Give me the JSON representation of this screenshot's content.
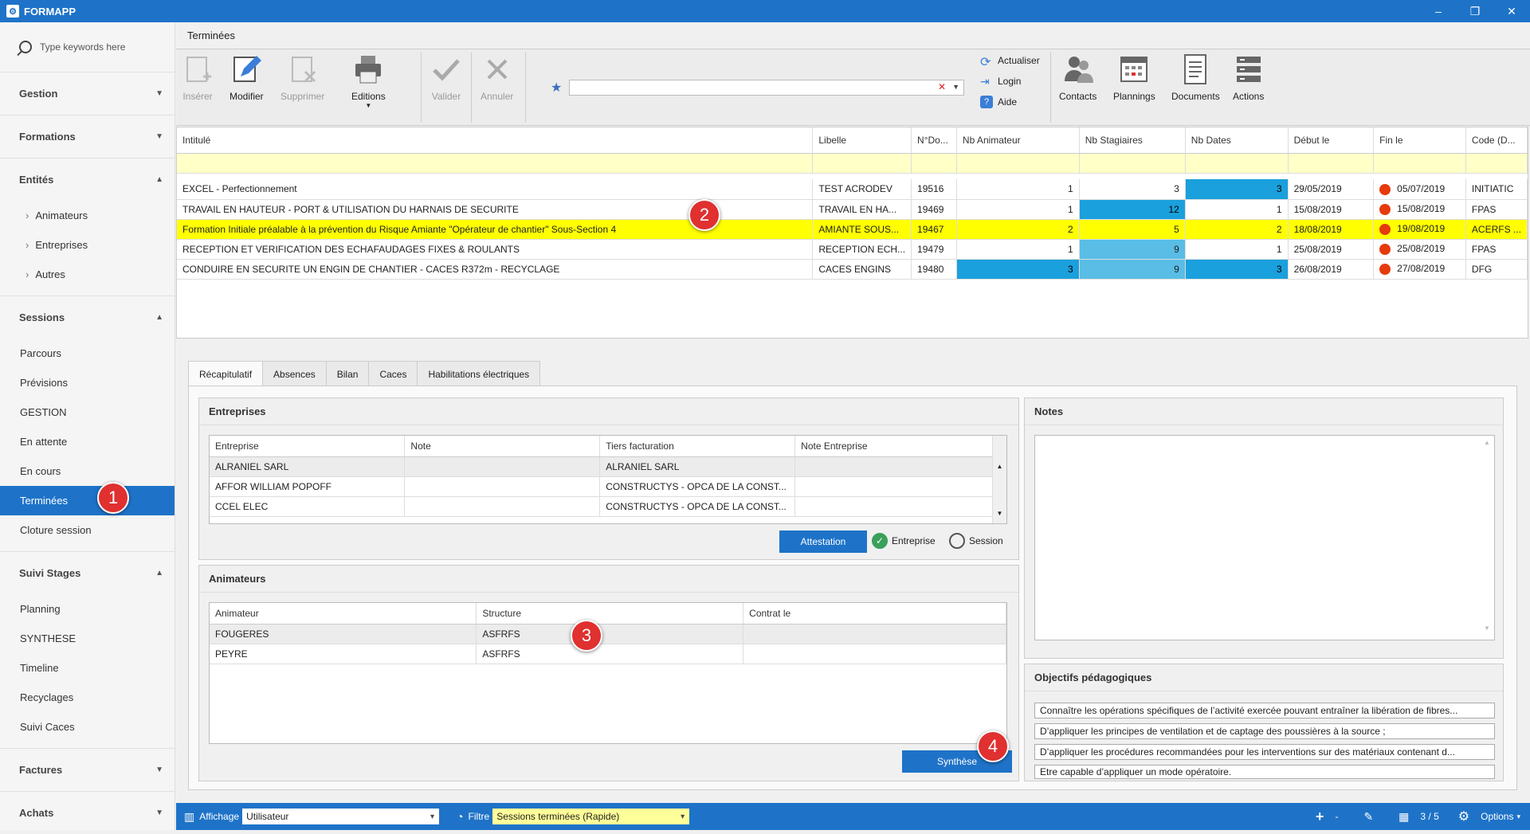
{
  "app": {
    "title": "FORMAPP"
  },
  "sidebar": {
    "search_placeholder": "Type keywords here",
    "groups": [
      {
        "label": "Gestion"
      },
      {
        "label": "Formations"
      },
      {
        "label": "Entités",
        "items": [
          "Animateurs",
          "Entreprises",
          "Autres"
        ]
      },
      {
        "label": "Sessions",
        "items": [
          "Parcours",
          "Prévisions",
          "GESTION",
          "En attente",
          "En cours",
          "Terminées",
          "Cloture session"
        ]
      },
      {
        "label": "Suivi Stages",
        "items": [
          "Planning",
          "SYNTHESE",
          "Timeline",
          "Recyclages",
          "Suivi Caces"
        ]
      },
      {
        "label": "Factures"
      },
      {
        "label": "Achats"
      }
    ]
  },
  "main": {
    "tab_title": "Terminées"
  },
  "ribbon": {
    "insert": "Insérer",
    "edit": "Modifier",
    "delete": "Supprimer",
    "editions": "Editions",
    "validate": "Valider",
    "cancel": "Annuler",
    "refresh": "Actualiser",
    "login": "Login",
    "help": "Aide",
    "contacts": "Contacts",
    "plannings": "Plannings",
    "documents": "Documents",
    "actions": "Actions"
  },
  "grid": {
    "columns": [
      "Intitulé",
      "Libelle",
      "N°Do...",
      "Nb Animateur",
      "Nb Stagiaires",
      "Nb Dates",
      "Début le",
      "Fin le",
      "Code (D..."
    ],
    "rows": [
      {
        "intitule": "EXCEL - Perfectionnement",
        "libelle": "TEST ACRODEV",
        "num": "19516",
        "anim": "1",
        "stag": "3",
        "dates": "3",
        "debut": "29/05/2019",
        "fin": "05/07/2019",
        "code": "INITIATIC"
      },
      {
        "intitule": "TRAVAIL EN HAUTEUR - PORT & UTILISATION DU HARNAIS DE SECURITE",
        "libelle": "TRAVAIL EN HA...",
        "num": "19469",
        "anim": "1",
        "stag": "12",
        "dates": "1",
        "debut": "15/08/2019",
        "fin": "15/08/2019",
        "code": "FPAS"
      },
      {
        "intitule": "Formation Initiale préalable à la prévention du Risque Amiante \"Opérateur de chantier\" Sous-Section 4",
        "libelle": "AMIANTE SOUS...",
        "num": "19467",
        "anim": "2",
        "stag": "5",
        "dates": "2",
        "debut": "18/08/2019",
        "fin": "19/08/2019",
        "code": "ACERFS ..."
      },
      {
        "intitule": "RECEPTION ET VERIFICATION DES ECHAFAUDAGES FIXES & ROULANTS",
        "libelle": "RECEPTION ECH...",
        "num": "19479",
        "anim": "1",
        "stag": "9",
        "dates": "1",
        "debut": "25/08/2019",
        "fin": "25/08/2019",
        "code": "FPAS"
      },
      {
        "intitule": "CONDUIRE EN SECURITE UN ENGIN DE CHANTIER - CACES R372m - RECYCLAGE",
        "libelle": "CACES ENGINS",
        "num": "19480",
        "anim": "3",
        "stag": "9",
        "dates": "3",
        "debut": "26/08/2019",
        "fin": "27/08/2019",
        "code": "DFG"
      }
    ]
  },
  "detail": {
    "tabs": [
      "Récapitulatif",
      "Absences",
      "Bilan",
      "Caces",
      "Habilitations électriques"
    ],
    "entreprises": {
      "title": "Entreprises",
      "columns": [
        "Entreprise",
        "Note",
        "Tiers facturation",
        "Note Entreprise"
      ],
      "rows": [
        [
          "ALRANIEL SARL",
          "",
          "ALRANIEL SARL",
          ""
        ],
        [
          "AFFOR WILLIAM POPOFF",
          "",
          "CONSTRUCTYS - OPCA DE LA CONST...",
          ""
        ],
        [
          "CCEL ELEC",
          "",
          "CONSTRUCTYS - OPCA DE LA CONST...",
          ""
        ]
      ],
      "attestation": "Attestation",
      "opt_entreprise": "Entreprise",
      "opt_session": "Session"
    },
    "animateurs": {
      "title": "Animateurs",
      "columns": [
        "Animateur",
        "Structure",
        "Contrat le"
      ],
      "rows": [
        [
          "FOUGERES",
          "ASFRFS",
          ""
        ],
        [
          "PEYRE",
          "ASFRFS",
          ""
        ]
      ],
      "synthese": "Synthèse"
    },
    "notes": {
      "title": "Notes"
    },
    "objectifs": {
      "title": "Objectifs pédagogiques",
      "lines": [
        "Connaître les opérations spécifiques de l’activité exercée pouvant entraîner la libération de fibres...",
        "D’appliquer les principes de ventilation et de captage des poussières à la source ;",
        "D’appliquer les procédures recommandées pour les interventions sur des matériaux contenant d...",
        "Etre capable d’appliquer un mode opératoire."
      ]
    }
  },
  "statusbar": {
    "affichage_label": "Affichage",
    "affichage_value": "Utilisateur",
    "filtre_label": "Filtre",
    "filtre_value": "Sessions terminées (Rapide)",
    "pager": "3 / 5",
    "options": "Options"
  },
  "badges": [
    "1",
    "2",
    "3",
    "4"
  ],
  "colors": {
    "accent": "#1e73c8",
    "selected_row": "#ffff00",
    "status_dot": "#e63b0c"
  }
}
